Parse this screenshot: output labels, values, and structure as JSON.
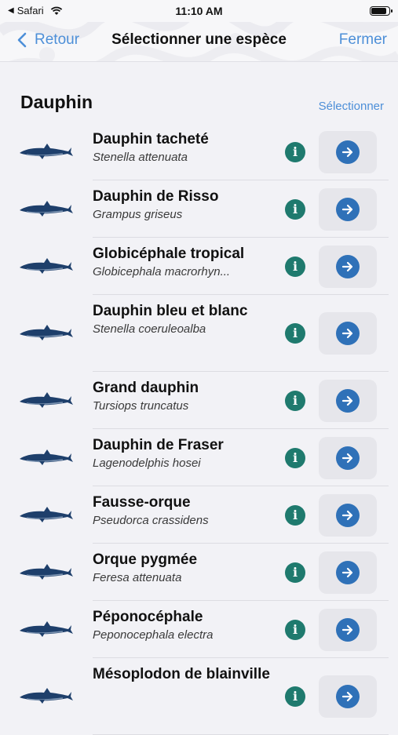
{
  "status_bar": {
    "back_app": "Safari",
    "time": "11:10 AM",
    "battery_level": 0.9
  },
  "nav": {
    "back_label": "Retour",
    "title": "Sélectionner une espèce",
    "close_label": "Fermer"
  },
  "section": {
    "title": "Dauphin",
    "action_label": "Sélectionner"
  },
  "colors": {
    "accent": "#4d8fd8",
    "info_badge": "#1f7a6e",
    "arrow_button": "#2f71b8"
  },
  "icons": {
    "back": "chevron-left-icon",
    "info": "info-icon",
    "go": "arrow-right-icon",
    "species": "dolphin-silhouette-icon"
  },
  "species": [
    {
      "common": "Dauphin tacheté",
      "scientific": "Stenella attenuata"
    },
    {
      "common": "Dauphin de Risso",
      "scientific": "Grampus griseus"
    },
    {
      "common": "Globicéphale tropical",
      "scientific": "Globicephala macrorhyn..."
    },
    {
      "common": "Dauphin bleu et blanc",
      "scientific": "Stenella coeruleoalba"
    },
    {
      "common": "Grand dauphin",
      "scientific": "Tursiops truncatus"
    },
    {
      "common": "Dauphin de Fraser",
      "scientific": "Lagenodelphis hosei"
    },
    {
      "common": "Fausse-orque",
      "scientific": "Pseudorca crassidens"
    },
    {
      "common": "Orque pygmée",
      "scientific": "Feresa attenuata"
    },
    {
      "common": "Péponocéphale",
      "scientific": "Peponocephala electra"
    },
    {
      "common": "Mésoplodon de blainville",
      "scientific": ""
    }
  ]
}
